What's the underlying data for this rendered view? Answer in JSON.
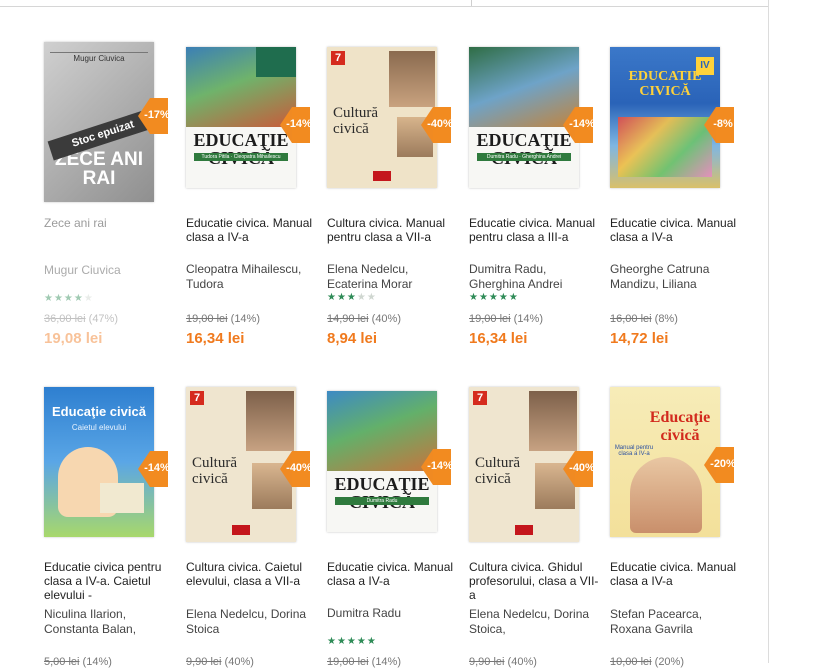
{
  "colors": {
    "accent_orange": "#f28b20",
    "price_orange": "#f07a1e",
    "star_green": "#2e8b57"
  },
  "products": [
    {
      "cover_title": "ZECE ANI RAI",
      "cover_author": "Mugur Ciuvica",
      "stoc": "Stoc epuizat",
      "discount": "-17%",
      "title": "Zece ani rai",
      "author": "Mugur Ciuvica",
      "old_price": "36,00 lei",
      "old_pct": "(47%)",
      "price": "19,08 lei",
      "rating": 4
    },
    {
      "cover_title": "EDUCAŢIE CIVICĂ",
      "cover_sub": "Tudora Pitila · Cleopatra Mihailescu",
      "discount": "-14%",
      "title": "Educatie civica. Manual clasa a IV-a",
      "author": "Cleopatra Mihailescu, Tudora",
      "old_price": "19,00 lei",
      "old_pct": "(14%)",
      "price": "16,34 lei",
      "rating": 0
    },
    {
      "cover_title": "Cultură civică",
      "cover_num": "7",
      "discount": "-40%",
      "title": "Cultura civica. Manual pentru clasa a VII-a",
      "author": "Elena Nedelcu, Ecaterina Morar",
      "old_price": "14,90 lei",
      "old_pct": "(40%)",
      "price": "8,94 lei",
      "rating": 3
    },
    {
      "cover_title": "EDUCAŢIE CIVICĂ",
      "cover_sub": "Dumitra Radu · Gherghina Andrei",
      "discount": "-14%",
      "title": "Educatie civica. Manual pentru clasa a III-a",
      "author": "Dumitra Radu, Gherghina Andrei",
      "old_price": "19,00 lei",
      "old_pct": "(14%)",
      "price": "16,34 lei",
      "rating": 5
    },
    {
      "cover_title": "EDUCATIE CIVICĂ",
      "cover_num": "IV",
      "discount": "-8%",
      "title": "Educatie civica. Manual clasa a IV-a",
      "author": "Gheorghe Catruna Mandizu, Liliana",
      "old_price": "16,00 lei",
      "old_pct": "(8%)",
      "price": "14,72 lei",
      "rating": 0
    },
    {
      "cover_title": "Educaţie civică",
      "cover_sub": "Caietul elevului",
      "discount": "-14%",
      "title": "Educatie civica pentru clasa a IV-a. Caietul elevului -",
      "author": "Niculina Ilarion, Constanta Balan,",
      "old_price": "5,00 lei",
      "old_pct": "(14%)",
      "rating": 0
    },
    {
      "cover_title": "Cultură civică",
      "cover_num": "7",
      "discount": "-40%",
      "title": "Cultura civica. Caietul elevului, clasa a VII-a",
      "author": "Elena Nedelcu, Dorina Stoica",
      "old_price": "9,90 lei",
      "old_pct": "(40%)",
      "rating": 0
    },
    {
      "cover_title": "EDUCAŢIE CIVICĂ",
      "cover_sub": "Dumitra Radu",
      "discount": "-14%",
      "title": "Educatie civica. Manual clasa a IV-a",
      "author": "Dumitra Radu",
      "old_price": "19,00 lei",
      "old_pct": "(14%)",
      "rating": 5
    },
    {
      "cover_title": "Cultură civică",
      "cover_num": "7",
      "discount": "-40%",
      "title": "Cultura civica. Ghidul profesorului, clasa a VII-a",
      "author": "Elena Nedelcu, Dorina Stoica,",
      "old_price": "9,90 lei",
      "old_pct": "(40%)",
      "rating": 0
    },
    {
      "cover_title": "Educaţie civică",
      "cover_sub": "Manual pentru clasa a IV-a",
      "discount": "-20%",
      "title": "Educatie civica. Manual clasa a IV-a",
      "author": "Stefan Pacearca, Roxana Gavrila",
      "old_price": "10,00 lei",
      "old_pct": "(20%)",
      "rating": 0
    }
  ]
}
